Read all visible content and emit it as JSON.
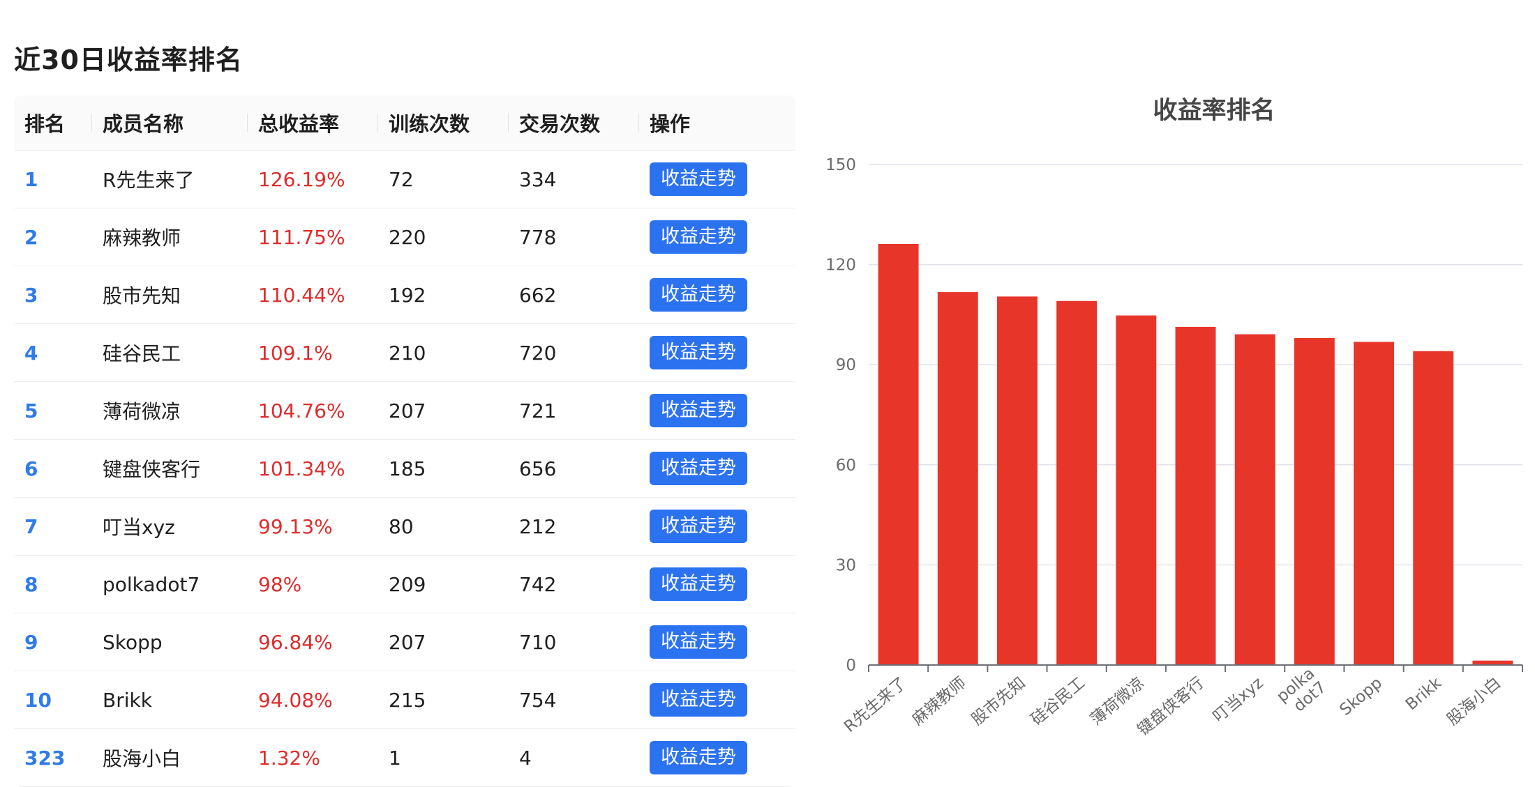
{
  "page_title": "近30日收益率排名",
  "table": {
    "headers": [
      "排名",
      "成员名称",
      "总收益率",
      "训练次数",
      "交易次数",
      "操作"
    ],
    "rows": [
      {
        "rank": "1",
        "name": "R先生来了",
        "rate": "126.19%",
        "trainings": "72",
        "trades": "334",
        "action": "收益走势"
      },
      {
        "rank": "2",
        "name": "麻辣教师",
        "rate": "111.75%",
        "trainings": "220",
        "trades": "778",
        "action": "收益走势"
      },
      {
        "rank": "3",
        "name": "股市先知",
        "rate": "110.44%",
        "trainings": "192",
        "trades": "662",
        "action": "收益走势"
      },
      {
        "rank": "4",
        "name": "硅谷民工",
        "rate": "109.1%",
        "trainings": "210",
        "trades": "720",
        "action": "收益走势"
      },
      {
        "rank": "5",
        "name": "薄荷微凉",
        "rate": "104.76%",
        "trainings": "207",
        "trades": "721",
        "action": "收益走势"
      },
      {
        "rank": "6",
        "name": "键盘侠客行",
        "rate": "101.34%",
        "trainings": "185",
        "trades": "656",
        "action": "收益走势"
      },
      {
        "rank": "7",
        "name": "叮当xyz",
        "rate": "99.13%",
        "trainings": "80",
        "trades": "212",
        "action": "收益走势"
      },
      {
        "rank": "8",
        "name": "polkadot7",
        "rate": "98%",
        "trainings": "209",
        "trades": "742",
        "action": "收益走势"
      },
      {
        "rank": "9",
        "name": "Skopp",
        "rate": "96.84%",
        "trainings": "207",
        "trades": "710",
        "action": "收益走势"
      },
      {
        "rank": "10",
        "name": "Brikk",
        "rate": "94.08%",
        "trainings": "215",
        "trades": "754",
        "action": "收益走势"
      },
      {
        "rank": "323",
        "name": "股海小白",
        "rate": "1.32%",
        "trainings": "1",
        "trades": "4",
        "action": "收益走势"
      }
    ]
  },
  "chart_data": {
    "type": "bar",
    "title": "收益率排名",
    "categories": [
      "R先生来了",
      "麻辣教师",
      "股市先知",
      "硅谷民工",
      "薄荷微凉",
      "键盘侠客行",
      "叮当xyz",
      "polkadot7",
      "Skopp",
      "Brikk",
      "股海小白"
    ],
    "category_label_lines": [
      [
        "R先生来了"
      ],
      [
        "麻辣教师"
      ],
      [
        "股市先知"
      ],
      [
        "硅谷民工"
      ],
      [
        "薄荷微凉"
      ],
      [
        "键盘侠客行"
      ],
      [
        "叮当xyz"
      ],
      [
        "polka",
        "dot7"
      ],
      [
        "Skopp"
      ],
      [
        "Brikk"
      ],
      [
        "股海小白"
      ]
    ],
    "values": [
      126.19,
      111.75,
      110.44,
      109.1,
      104.76,
      101.34,
      99.13,
      98,
      96.84,
      94.08,
      1.32
    ],
    "ylim": [
      0,
      150
    ],
    "yticks": [
      "0",
      "30",
      "60",
      "90",
      "120",
      "150"
    ],
    "xlabel": "",
    "ylabel": "",
    "grid": true,
    "bar_color": "#e8352a"
  },
  "colors": {
    "rank": "#2f7be8",
    "rate": "#e02b2b",
    "button": "#2b72f0"
  }
}
